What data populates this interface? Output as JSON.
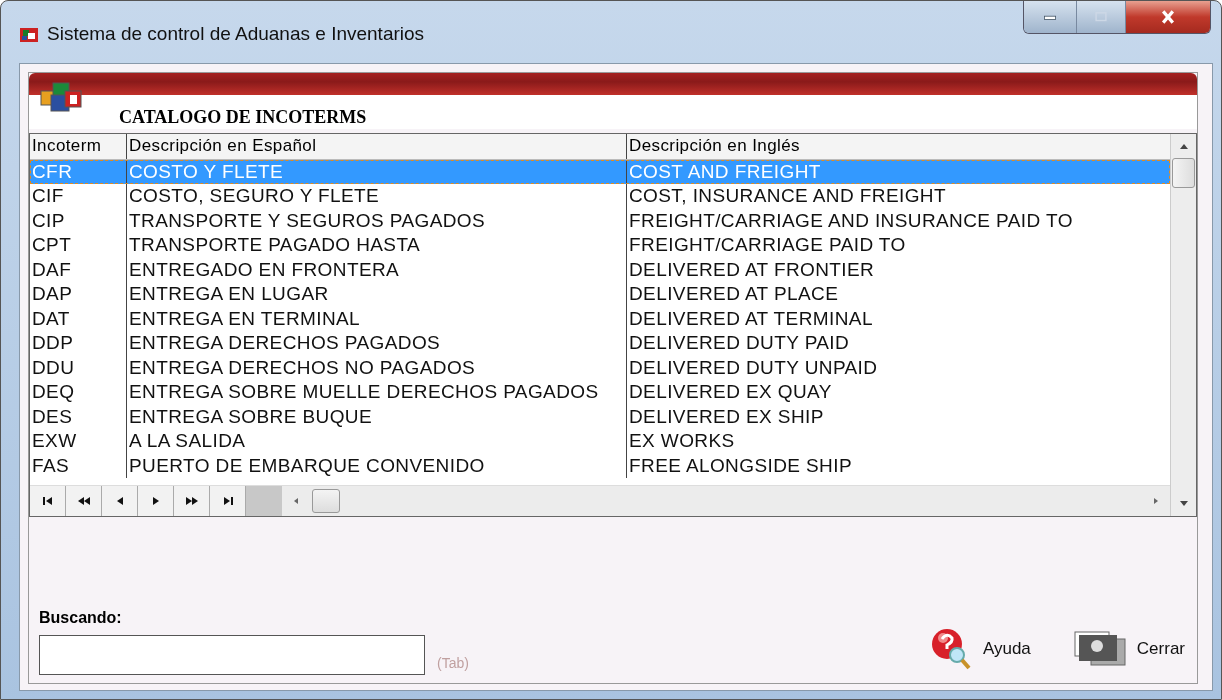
{
  "window": {
    "title": "Sistema de control de Aduanas e Inventarios"
  },
  "heading": "CATALOGO DE INCOTERMS",
  "table": {
    "columns": [
      "Incoterm",
      "Descripción en  Español",
      "Descripción en Inglés"
    ],
    "rows": [
      {
        "cells": [
          "CFR",
          "COSTO Y FLETE",
          "COST AND FREIGHT"
        ],
        "selected": true
      },
      {
        "cells": [
          "CIF",
          "COSTO, SEGURO Y FLETE",
          "COST, INSURANCE AND FREIGHT"
        ],
        "selected": false
      },
      {
        "cells": [
          "CIP",
          "TRANSPORTE Y SEGUROS PAGADOS",
          "FREIGHT/CARRIAGE AND INSURANCE PAID TO"
        ],
        "selected": false
      },
      {
        "cells": [
          "CPT",
          "TRANSPORTE PAGADO HASTA",
          "FREIGHT/CARRIAGE PAID TO"
        ],
        "selected": false
      },
      {
        "cells": [
          "DAF",
          "ENTREGADO EN FRONTERA",
          "DELIVERED AT FRONTIER"
        ],
        "selected": false
      },
      {
        "cells": [
          "DAP",
          "ENTREGA EN LUGAR",
          "DELIVERED AT PLACE"
        ],
        "selected": false
      },
      {
        "cells": [
          "DAT",
          "ENTREGA EN TERMINAL",
          "DELIVERED AT TERMINAL"
        ],
        "selected": false
      },
      {
        "cells": [
          "DDP",
          "ENTREGA DERECHOS PAGADOS",
          "DELIVERED DUTY PAID"
        ],
        "selected": false
      },
      {
        "cells": [
          "DDU",
          "ENTREGA DERECHOS NO PAGADOS",
          "DELIVERED DUTY UNPAID"
        ],
        "selected": false
      },
      {
        "cells": [
          "DEQ",
          "ENTREGA SOBRE MUELLE DERECHOS PAGADOS",
          "DELIVERED EX QUAY"
        ],
        "selected": false
      },
      {
        "cells": [
          "DES",
          "ENTREGA SOBRE BUQUE",
          "DELIVERED EX SHIP"
        ],
        "selected": false
      },
      {
        "cells": [
          "EXW",
          "A LA SALIDA",
          "EX WORKS"
        ],
        "selected": false
      },
      {
        "cells": [
          "FAS",
          "PUERTO DE EMBARQUE CONVENIDO",
          "FREE ALONGSIDE SHIP"
        ],
        "selected": false
      }
    ]
  },
  "search": {
    "label": "Buscando:",
    "hint": "(Tab)"
  },
  "buttons": [
    {
      "kind": "help",
      "label": "Ayuda"
    },
    {
      "kind": "close",
      "label": "Cerrar"
    }
  ]
}
